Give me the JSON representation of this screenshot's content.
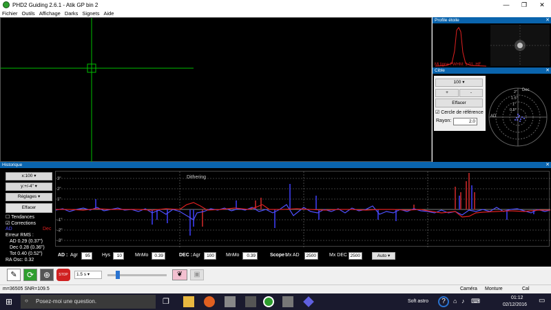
{
  "window": {
    "title": "PHD2 Guiding 2.6.1 - Atik GP bin 2",
    "min": "—",
    "max": "❐",
    "close": "✕"
  },
  "menu": [
    "Fichier",
    "Outils",
    "Affichage",
    "Darks",
    "Signets",
    "Aide"
  ],
  "profile": {
    "title": "Profile étoile",
    "fwhm": "Mi ligne FWHM: 1.01, HF"
  },
  "target": {
    "title": "Cible",
    "scale": "100",
    "plus": "+",
    "minus": "-",
    "clear": "Effacer",
    "ref_circle": "Cercle de référence",
    "radius_label": "Rayon:",
    "radius": "2.0",
    "ra_label": "AD",
    "dec_label": "Dec",
    "rings": [
      "2\"",
      "1.5\"",
      "1\"",
      "0.5\""
    ]
  },
  "history": {
    "title": "Historique",
    "xscale": "x:100",
    "yscale": "y:+/-4\"",
    "settings": "Réglages",
    "clear": "Effacer",
    "trends": "Tendances",
    "corrections": "Corrections",
    "ra_legend": "AD",
    "dec_legend": "Dec",
    "rms_title": "Erreur RMS :",
    "rms_ra": "AD 0.29 (0.37\")",
    "rms_dec": "Dec 0.28 (0.36\")",
    "rms_tot": "Tot 0.40 (0.52\")",
    "ra_osc": "RA Osc: 0.32",
    "dithering": "Dithering",
    "ylabels": [
      "3\"",
      "2\"",
      "1\"",
      "-1\"",
      "-2\"",
      "-3\""
    ],
    "params": {
      "ad": "AD :",
      "agr": "Agr",
      "ra_agr": "95",
      "hys": "Hys",
      "ra_hys": "10",
      "mnmo": "MnMo",
      "ra_mnmo": "0.39",
      "dec": "DEC :",
      "dec_agr": "100",
      "dec_mnmo": "0.39",
      "scope": "Scope :",
      "mxad": "Mx AD",
      "mxad_val": "2500",
      "mxdec": "Mx DEC",
      "mxdec_val": "2500",
      "mode": "Auto"
    }
  },
  "toolbar": {
    "exposure": "1.5 s"
  },
  "status": {
    "left": "m=36505 SNR=109.5",
    "camera": "Caméra",
    "mount": "Monture",
    "cal": "Cal"
  },
  "taskbar": {
    "search": "Posez-moi une question.",
    "tray_label": "Soft astro",
    "time": "01:12",
    "date": "02/12/2016"
  },
  "colors": {
    "ra": "#5050ff",
    "dec": "#e02020",
    "crosshair": "#00c000",
    "panel_title": "#0a64ad"
  }
}
